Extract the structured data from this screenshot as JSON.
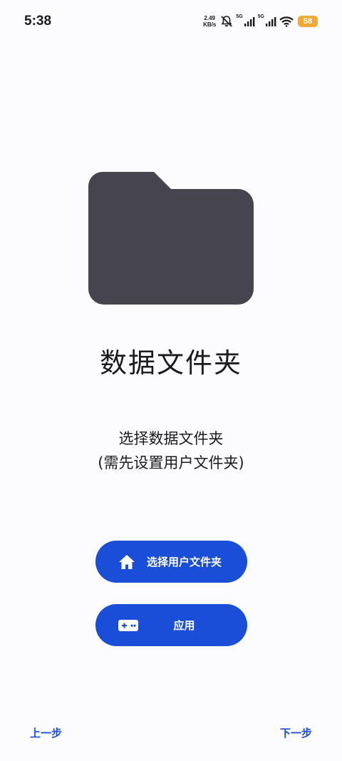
{
  "status_bar": {
    "time": "5:38",
    "net_speed_value": "2.49",
    "net_speed_unit": "KB/s",
    "sim1_label": "5G",
    "sim2_label": "5G",
    "battery": "58",
    "icons": [
      "mute-icon",
      "signal-icon",
      "signal-icon",
      "wifi-icon",
      "battery-icon"
    ],
    "battery_color": "#f2a93b"
  },
  "main": {
    "illustration_icon": "folder-icon",
    "illustration_color": "#46444f",
    "title": "数据文件夹",
    "description_line1": "选择数据文件夹",
    "description_line2": "(需先设置用户文件夹)"
  },
  "buttons": {
    "select_user_folder": {
      "label": "选择用户文件夹",
      "icon": "home-icon"
    },
    "apply": {
      "label": "应用",
      "icon": "gamepad-icon"
    },
    "accent_color": "#1a4ed8"
  },
  "navigation": {
    "prev_label": "上一步",
    "next_label": "下一步"
  }
}
